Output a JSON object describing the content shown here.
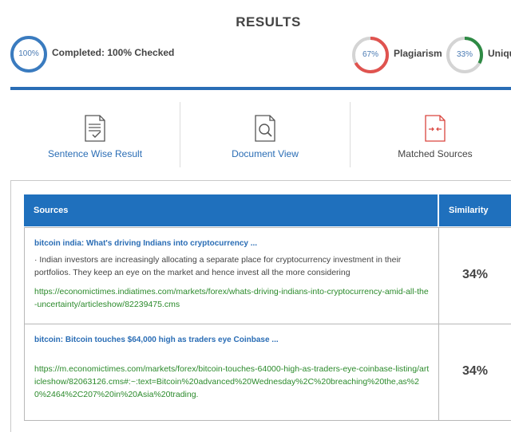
{
  "title": "RESULTS",
  "stats": {
    "completed": {
      "ring_label": "100%",
      "text": "Completed: 100% Checked",
      "percent": 100,
      "color": "#3a7bbf"
    },
    "plagiarism": {
      "ring_label": "67%",
      "text": "Plagiarism",
      "percent": 67,
      "color": "#e0534f",
      "track": "#d4d4d4"
    },
    "unique": {
      "ring_label": "33%",
      "text": "Uniqu",
      "percent": 33,
      "color": "#2e8a44",
      "track": "#d4d4d4"
    }
  },
  "tabs": [
    {
      "label": "Sentence Wise Result",
      "icon": "checklist-document-icon"
    },
    {
      "label": "Document View",
      "icon": "document-search-icon"
    },
    {
      "label": "Matched Sources",
      "icon": "compare-document-icon"
    }
  ],
  "table": {
    "headers": {
      "sources": "Sources",
      "similarity": "Similarity"
    },
    "rows": [
      {
        "title": "bitcoin india: What's driving Indians into cryptocurrency ...",
        "snippet": " · Indian investors are increasingly allocating a separate place for cryptocurrency investment in their portfolios. They keep an eye on the market and hence invest all the more considering",
        "url": "https://economictimes.indiatimes.com/markets/forex/whats-driving-indians-into-cryptocurrency-amid-all-the-uncertainty/articleshow/82239475.cms",
        "similarity": "34%"
      },
      {
        "title": "bitcoin: Bitcoin touches $64,000 high as traders eye Coinbase ...",
        "snippet": "",
        "url": "https://m.economictimes.com/markets/forex/bitcoin-touches-64000-high-as-traders-eye-coinbase-listing/articleshow/82063126.cms#:~:text=Bitcoin%20advanced%20Wednesday%2C%20breaching%20the,as%20%2464%2C207%20in%20Asia%20trading.",
        "similarity": "34%"
      }
    ]
  },
  "colors": {
    "accent": "#2a6db5",
    "header_bg": "#1f70bd",
    "link_green": "#2b8a2b"
  }
}
